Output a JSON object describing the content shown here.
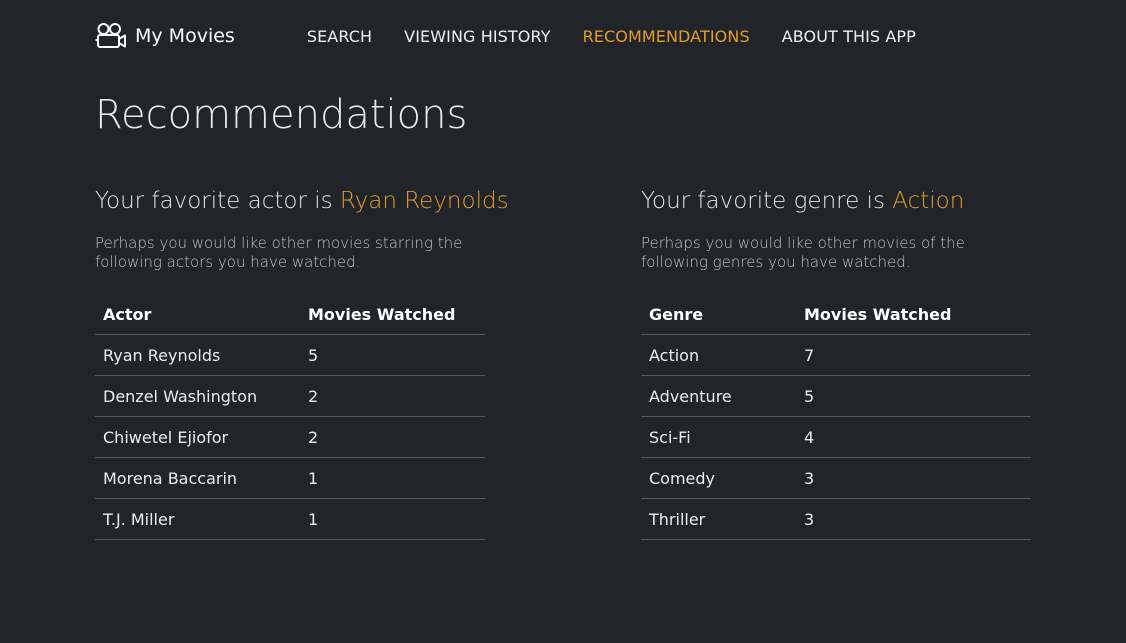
{
  "app": {
    "brand_icon": "film-camera-icon",
    "name": "My Movies"
  },
  "nav": {
    "items": [
      {
        "label": "SEARCH",
        "active": false
      },
      {
        "label": "VIEWING HISTORY",
        "active": false
      },
      {
        "label": "RECOMMENDATIONS",
        "active": true
      },
      {
        "label": "ABOUT THIS APP",
        "active": false
      }
    ]
  },
  "page": {
    "title": "Recommendations"
  },
  "colors": {
    "background": "#212428",
    "accent": "#e59c2b",
    "text": "#e6e6e6"
  },
  "actor_section": {
    "heading_prefix": "Your favorite actor is ",
    "favorite": "Ryan Reynolds",
    "description": "Perhaps you would like other movies starring the following actors you have watched.",
    "columns": [
      "Actor",
      "Movies Watched"
    ],
    "rows": [
      [
        "Ryan Reynolds",
        "5"
      ],
      [
        "Denzel Washington",
        "2"
      ],
      [
        "Chiwetel Ejiofor",
        "2"
      ],
      [
        "Morena Baccarin",
        "1"
      ],
      [
        "T.J. Miller",
        "1"
      ]
    ]
  },
  "genre_section": {
    "heading_prefix": "Your favorite genre is ",
    "favorite": "Action",
    "description": "Perhaps you would like other movies of the following genres you have watched.",
    "columns": [
      "Genre",
      "Movies Watched"
    ],
    "rows": [
      [
        "Action",
        "7"
      ],
      [
        "Adventure",
        "5"
      ],
      [
        "Sci-Fi",
        "4"
      ],
      [
        "Comedy",
        "3"
      ],
      [
        "Thriller",
        "3"
      ]
    ]
  }
}
